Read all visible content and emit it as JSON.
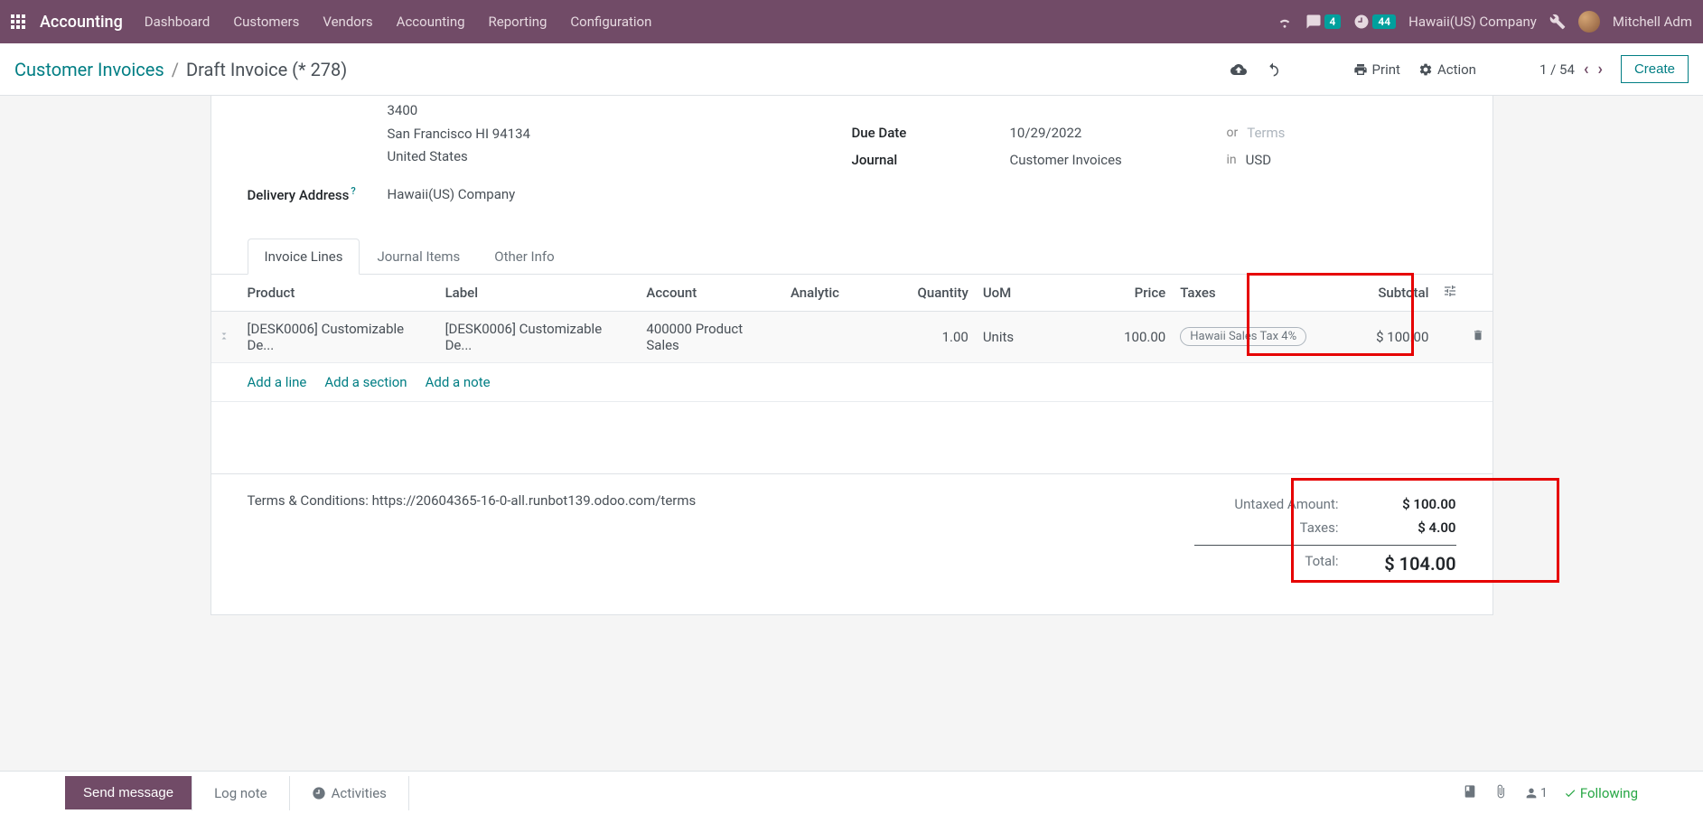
{
  "navbar": {
    "brand": "Accounting",
    "menu": [
      "Dashboard",
      "Customers",
      "Vendors",
      "Accounting",
      "Reporting",
      "Configuration"
    ],
    "messages_count": "4",
    "activities_count": "44",
    "company": "Hawaii(US) Company",
    "user": "Mitchell Adm"
  },
  "breadcrumb": {
    "parent": "Customer Invoices",
    "current": "Draft Invoice (* 278)"
  },
  "controls": {
    "print": "Print",
    "action": "Action",
    "pager": "1 / 54",
    "create": "Create"
  },
  "info": {
    "address_lines": [
      "3400",
      "San Francisco HI 94134",
      "United States"
    ],
    "delivery_label": "Delivery Address",
    "delivery_value": "Hawaii(US) Company",
    "due_date_label": "Due Date",
    "due_date_value": "10/29/2022",
    "or": "or",
    "terms_placeholder": "Terms",
    "journal_label": "Journal",
    "journal_value": "Customer Invoices",
    "in": "in",
    "currency": "USD"
  },
  "tabs": [
    "Invoice Lines",
    "Journal Items",
    "Other Info"
  ],
  "table": {
    "headers": {
      "product": "Product",
      "label": "Label",
      "account": "Account",
      "analytic": "Analytic",
      "quantity": "Quantity",
      "uom": "UoM",
      "price": "Price",
      "taxes": "Taxes",
      "subtotal": "Subtotal"
    },
    "row": {
      "product": "[DESK0006] Customizable De...",
      "label": "[DESK0006] Customizable De...",
      "account": "400000 Product Sales",
      "analytic": "",
      "quantity": "1.00",
      "uom": "Units",
      "price": "100.00",
      "tax": "Hawaii Sales Tax 4%",
      "subtotal": "$ 100.00"
    },
    "add_line": "Add a line",
    "add_section": "Add a section",
    "add_note": "Add a note"
  },
  "terms_text": "Terms & Conditions: https://20604365-16-0-all.runbot139.odoo.com/terms",
  "totals": {
    "untaxed_label": "Untaxed Amount:",
    "untaxed_value": "$ 100.00",
    "taxes_label": "Taxes:",
    "taxes_value": "$ 4.00",
    "total_label": "Total:",
    "total_value": "$ 104.00"
  },
  "chatter": {
    "send": "Send message",
    "log": "Log note",
    "activities": "Activities",
    "followers": "1",
    "following": "Following"
  }
}
